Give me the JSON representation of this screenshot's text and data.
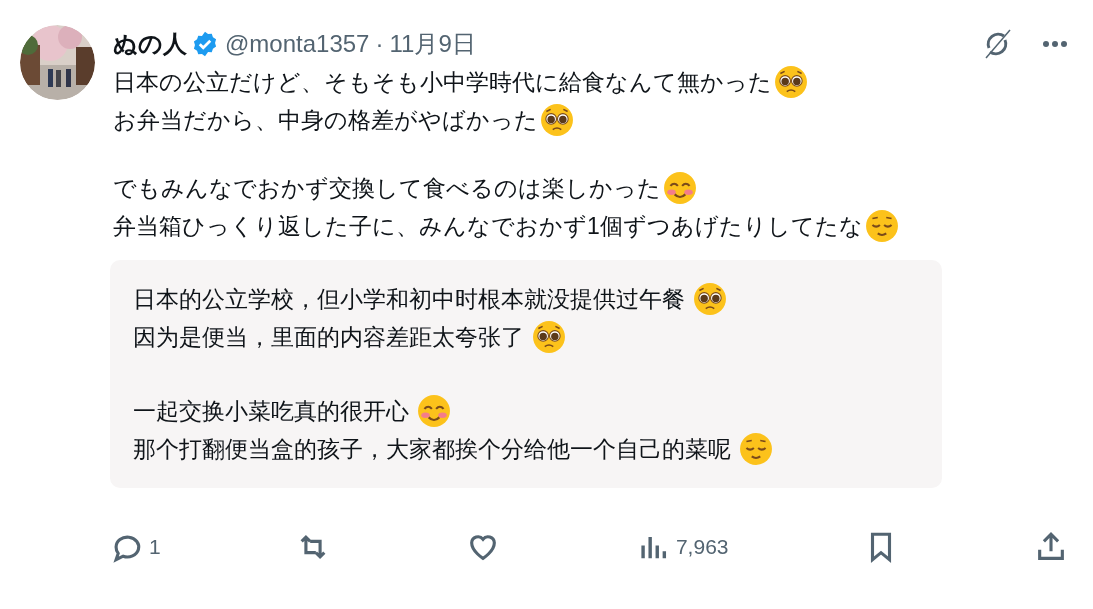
{
  "author": {
    "name": "ぬの人",
    "verified": true,
    "handle": "@monta1357",
    "separator": "·",
    "date": "11月9日"
  },
  "paragraphs": [
    [
      {
        "text": "日本の公立だけど、そもそも小中学時代に給食なんて無かった",
        "kind": "pleading"
      },
      {
        "text": "お弁当だから、中身の格差がやばかった",
        "kind": "pleading"
      }
    ],
    [
      {
        "text": "でもみんなでおかず交換して食べるのは楽しかった",
        "kind": "blush"
      },
      {
        "text": "弁当箱ひっくり返した子に、みんなでおかず1個ずつあげたりしてたな",
        "kind": "relieved"
      }
    ]
  ],
  "translation": [
    [
      {
        "text": "日本的公立学校，但小学和初中时根本就没提供过午餐 ",
        "kind": "pleading"
      },
      {
        "text": "因为是便当，里面的内容差距太夸张了 ",
        "kind": "pleading"
      }
    ],
    [
      {
        "text": "一起交换小菜吃真的很开心 ",
        "kind": "blush"
      },
      {
        "text": "那个打翻便当盒的孩子，大家都挨个分给他一个自己的菜呢 ",
        "kind": "relieved"
      }
    ]
  ],
  "actions": [
    {
      "kind": "reply",
      "count": "1"
    },
    {
      "kind": "repost"
    },
    {
      "kind": "like"
    },
    {
      "kind": "views",
      "count": "7,963"
    },
    {
      "kind": "bookmark"
    },
    {
      "kind": "share"
    }
  ]
}
